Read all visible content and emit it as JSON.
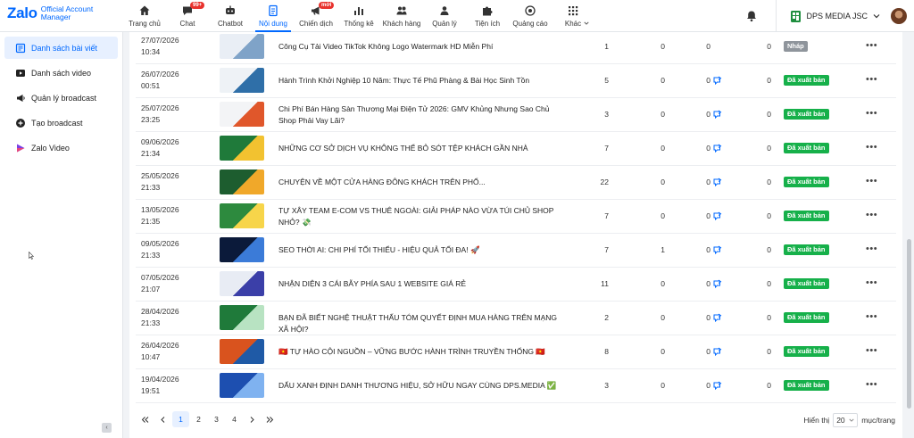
{
  "logo": {
    "brand": "Zalo",
    "line1": "Official Account",
    "line2": "Manager"
  },
  "nav": [
    {
      "label": "Trang chủ",
      "icon": "home-icon"
    },
    {
      "label": "Chat",
      "icon": "chat-icon",
      "badge": "99+"
    },
    {
      "label": "Chatbot",
      "icon": "robot-icon"
    },
    {
      "label": "Nội dung",
      "icon": "document-icon",
      "active": true
    },
    {
      "label": "Chiến dịch",
      "icon": "megaphone-icon",
      "badge": "mới"
    },
    {
      "label": "Thống kê",
      "icon": "bar-chart-icon"
    },
    {
      "label": "Khách hàng",
      "icon": "users-icon"
    },
    {
      "label": "Quản lý",
      "icon": "user-manage-icon"
    },
    {
      "label": "Tiện ích",
      "icon": "puzzle-icon"
    },
    {
      "label": "Quảng cáo",
      "icon": "ads-icon"
    },
    {
      "label": "Khác",
      "icon": "grid-icon"
    }
  ],
  "account": {
    "name": "DPS MEDIA JSC"
  },
  "sidebar": [
    {
      "label": "Danh sách bài viết",
      "icon": "article-list-icon",
      "active": true
    },
    {
      "label": "Danh sách video",
      "icon": "video-list-icon"
    },
    {
      "label": "Quản lý broadcast",
      "icon": "broadcast-icon"
    },
    {
      "label": "Tạo broadcast",
      "icon": "add-circle-icon"
    },
    {
      "label": "Zalo Video",
      "icon": "zalo-video-icon"
    }
  ],
  "colors": {
    "accent": "#0068ff",
    "published": "#16b04a",
    "draft": "#8f959c"
  },
  "rows": [
    {
      "date": "27/07/2026",
      "time": "10:34",
      "title": "Công Cụ Tải Video TikTok Không Logo Watermark HD Miễn Phí",
      "c1": "1",
      "c2": "0",
      "c3": "0",
      "c4": "0",
      "share": false,
      "status": "Nháp",
      "status_type": "draft",
      "thumb": [
        "#e9eef5",
        "#7fa3c8"
      ]
    },
    {
      "date": "26/07/2026",
      "time": "00:51",
      "title": "Hành Trình Khởi Nghiệp 10 Năm: Thực Tế Phũ Phàng & Bài Học Sinh Tồn",
      "c1": "5",
      "c2": "0",
      "c3": "0",
      "c4": "0",
      "share": true,
      "status": "Đã xuất bản",
      "status_type": "pub",
      "thumb": [
        "#eef2f6",
        "#2f6fa8"
      ]
    },
    {
      "date": "25/07/2026",
      "time": "23:25",
      "title": "Chi Phí Bán Hàng Sàn Thương Mại Điện Tử 2026: GMV Khủng Nhưng Sao Chủ Shop Phải Vay Lãi?",
      "c1": "3",
      "c2": "0",
      "c3": "0",
      "c4": "0",
      "share": true,
      "status": "Đã xuất bản",
      "status_type": "pub",
      "thumb": [
        "#f3f4f6",
        "#e0572b"
      ]
    },
    {
      "date": "09/06/2026",
      "time": "21:34",
      "title": "NHỮNG CƠ SỞ DỊCH VỤ KHÔNG THỂ BỎ SÓT TỆP KHÁCH GẦN NHÀ",
      "c1": "7",
      "c2": "0",
      "c3": "0",
      "c4": "0",
      "share": true,
      "status": "Đã xuất bản",
      "status_type": "pub",
      "thumb": [
        "#1f7a3a",
        "#f2c230"
      ]
    },
    {
      "date": "25/05/2026",
      "time": "21:33",
      "title": "CHUYỆN VỀ MỘT CỬA HÀNG ĐÔNG KHÁCH TRÊN PHỐ...",
      "c1": "22",
      "c2": "0",
      "c3": "0",
      "c4": "0",
      "share": true,
      "status": "Đã xuất bản",
      "status_type": "pub",
      "thumb": [
        "#1d5d2f",
        "#f0a82a"
      ]
    },
    {
      "date": "13/05/2026",
      "time": "21:35",
      "title": "TỰ XÂY TEAM E-COM VS THUÊ NGOÀI: GIẢI PHÁP NÀO VỪA TÚI CHỦ SHOP NHỎ? 💸",
      "c1": "7",
      "c2": "0",
      "c3": "0",
      "c4": "0",
      "share": true,
      "status": "Đã xuất bản",
      "status_type": "pub",
      "thumb": [
        "#2d8a3e",
        "#f7d54a"
      ]
    },
    {
      "date": "09/05/2026",
      "time": "21:33",
      "title": "SEO THỜI AI: CHI PHÍ TỐI THIỂU - HIỆU QUẢ TỐI ĐA! 🚀",
      "c1": "7",
      "c2": "1",
      "c3": "0",
      "c4": "0",
      "share": true,
      "status": "Đã xuất bản",
      "status_type": "pub",
      "thumb": [
        "#0b1a3a",
        "#3b7bd8"
      ]
    },
    {
      "date": "07/05/2026",
      "time": "21:07",
      "title": "NHẬN DIỆN 3 CÁI BẪY PHÍA SAU 1 WEBSITE GIÁ RẺ",
      "c1": "11",
      "c2": "0",
      "c3": "0",
      "c4": "0",
      "share": true,
      "status": "Đã xuất bản",
      "status_type": "pub",
      "thumb": [
        "#e8ecf4",
        "#3b3fa8"
      ]
    },
    {
      "date": "28/04/2026",
      "time": "21:33",
      "title": "BẠN ĐÃ BIẾT NGHỆ THUẬT THẤU TÓM QUYẾT ĐỊNH MUA HÀNG TRÊN MẠNG XÃ HỘI?",
      "c1": "2",
      "c2": "0",
      "c3": "0",
      "c4": "0",
      "share": true,
      "status": "Đã xuất bản",
      "status_type": "pub",
      "thumb": [
        "#1f7a3a",
        "#b8e3c2"
      ]
    },
    {
      "date": "26/04/2026",
      "time": "10:47",
      "title": "🇻🇳 TỰ HÀO CỘI NGUỒN – VỮNG BƯỚC HÀNH TRÌNH TRUYỀN THỐNG 🇻🇳",
      "c1": "8",
      "c2": "0",
      "c3": "0",
      "c4": "0",
      "share": true,
      "status": "Đã xuất bản",
      "status_type": "pub",
      "thumb": [
        "#d9531e",
        "#1f5aa6"
      ]
    },
    {
      "date": "19/04/2026",
      "time": "19:51",
      "title": "DẤU XANH ĐỊNH DANH THƯƠNG HIỆU, SỞ HỮU NGAY CÙNG DPS.MEDIA ✅",
      "c1": "3",
      "c2": "0",
      "c3": "0",
      "c4": "0",
      "share": true,
      "status": "Đã xuất bản",
      "status_type": "pub",
      "thumb": [
        "#1d4fb0",
        "#7fb2f0"
      ]
    }
  ],
  "pagination": {
    "pages": [
      "1",
      "2",
      "3",
      "4"
    ],
    "active": "1"
  },
  "page_size": {
    "label": "Hiển thị",
    "value": "20",
    "suffix": "mục/trang"
  }
}
